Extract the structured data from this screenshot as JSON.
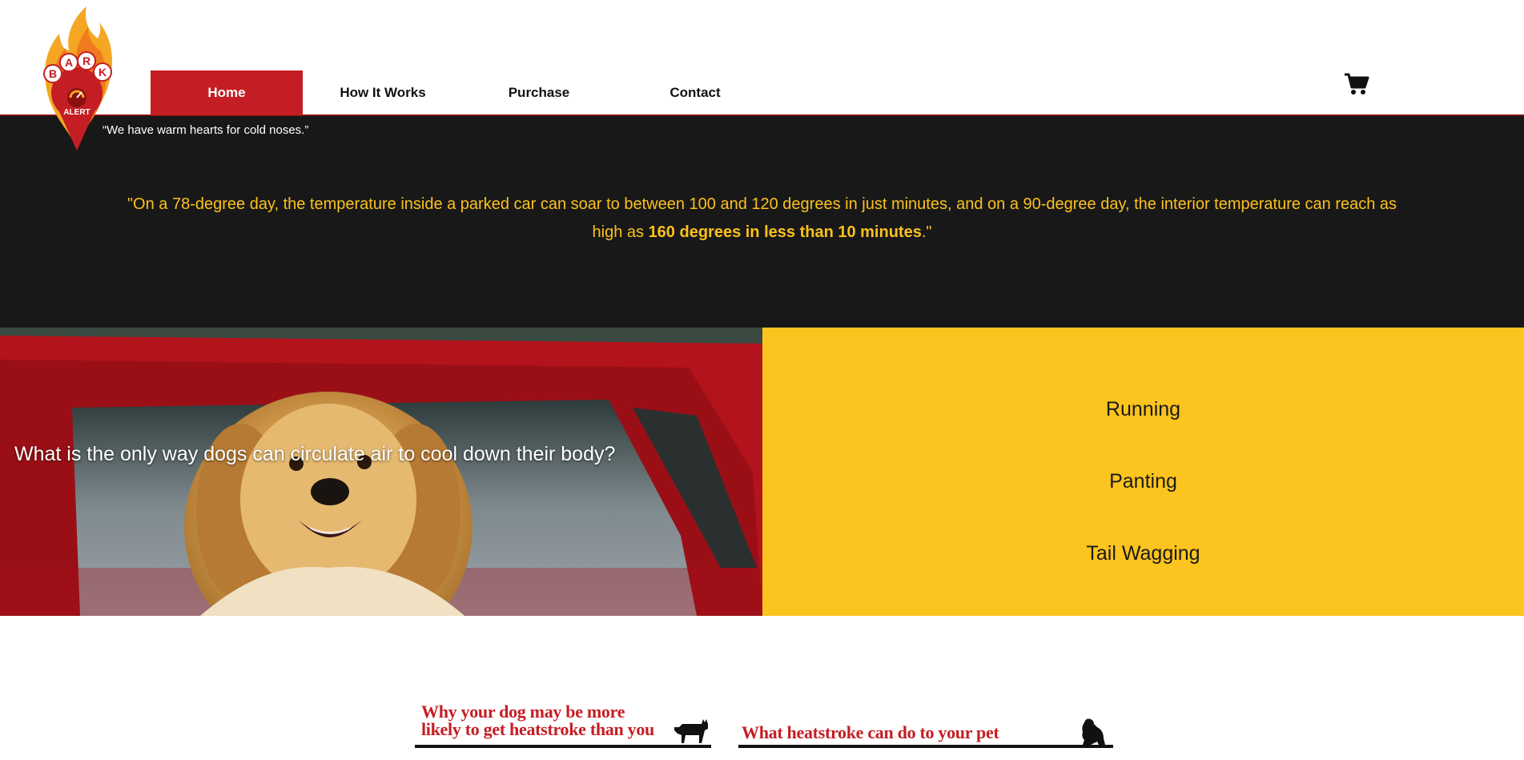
{
  "brand": {
    "logo_letters": [
      "B",
      "A",
      "R",
      "K"
    ],
    "logo_subtext": "ALERT",
    "tagline": "“We have warm hearts for cold noses.”"
  },
  "nav": {
    "items": [
      {
        "label": "Home",
        "active": true
      },
      {
        "label": "How It Works",
        "active": false
      },
      {
        "label": "Purchase",
        "active": false
      },
      {
        "label": "Contact",
        "active": false
      }
    ],
    "cart_icon": "shopping-cart-icon"
  },
  "quote": {
    "text_start": "\"On a 78-degree day, the temperature inside a parked car can soar to between 100 and 120 degrees in just minutes, and on a 90-degree day, the interior temperature can reach as high as ",
    "text_bold": "160 degrees in less than 10 minutes",
    "text_end": ".\""
  },
  "quiz": {
    "question": "What is the only way dogs can circulate air to cool down their body?",
    "answers": [
      "Running",
      "Panting",
      "Tail Wagging"
    ]
  },
  "cards": [
    {
      "title_line1": "Why your dog may be more",
      "title_line2": "likely to get heatstroke than you",
      "icon": "terrier-silhouette-icon"
    },
    {
      "title_line1": "What heatstroke can do to your pet",
      "icon": "sitting-dog-silhouette-icon"
    }
  ],
  "colors": {
    "brand_red": "#c41e24",
    "quote_yellow": "#fcc11c",
    "answer_panel": "#fcc41e",
    "dark_band": "#181818"
  }
}
